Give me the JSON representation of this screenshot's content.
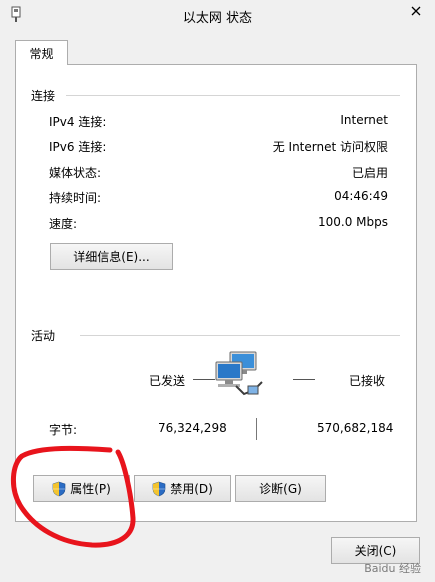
{
  "window": {
    "title": "以太网 状态",
    "close_icon": "close-icon",
    "close_color": "#c75050"
  },
  "tabs": [
    {
      "label": "常规"
    }
  ],
  "connection": {
    "title": "连接",
    "rows": [
      {
        "label": "IPv4 连接:",
        "value": "Internet"
      },
      {
        "label": "IPv6 连接:",
        "value": "无 Internet 访问权限"
      },
      {
        "label": "媒体状态:",
        "value": "已启用"
      },
      {
        "label": "持续时间:",
        "value": "04:46:49"
      },
      {
        "label": "速度:",
        "value": "100.0 Mbps"
      }
    ],
    "details_button": "详细信息(E)..."
  },
  "activity": {
    "title": "活动",
    "sent_label": "已发送",
    "received_label": "已接收",
    "bytes_label": "字节:",
    "bytes_sent": "76,324,298",
    "bytes_received": "570,682,184"
  },
  "buttons": {
    "properties": "属性(P)",
    "disable": "禁用(D)",
    "diagnose": "诊断(G)",
    "close": "关闭(C)"
  },
  "annotation_color": "#e8141c",
  "watermark": "Baidu 经验"
}
